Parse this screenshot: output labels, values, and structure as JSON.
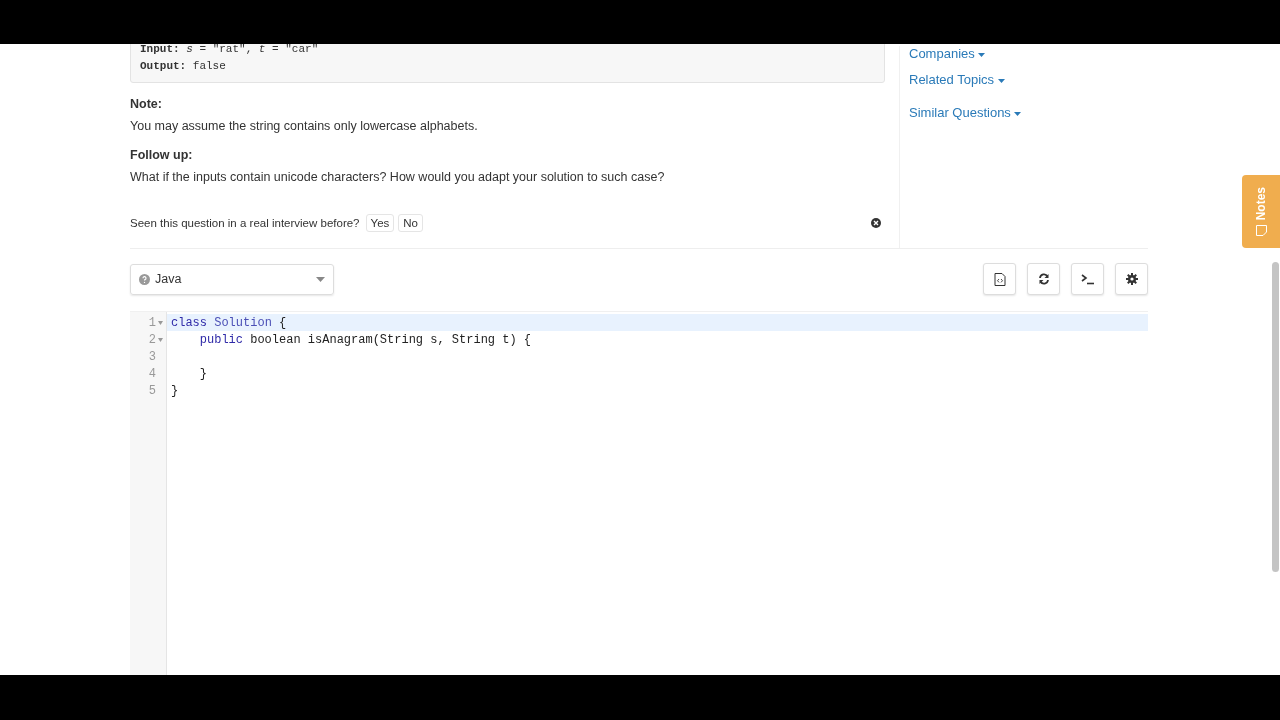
{
  "problem": {
    "example": [
      {
        "label": "Input:",
        "value": "*s* = \"rat\", *t* = \"car\""
      },
      {
        "label": "Output:",
        "value": "false"
      }
    ],
    "sections": [
      {
        "heading": "Note:",
        "text": "You may assume the string contains only lowercase alphabets."
      },
      {
        "heading": "Follow up:",
        "text": "What if the inputs contain unicode characters? How would you adapt your solution to such case?"
      }
    ],
    "feedback": {
      "question": "Seen this question in a real interview before?",
      "buttons": [
        "Yes",
        "No"
      ]
    }
  },
  "sidebar": {
    "links": [
      {
        "label": "Companies"
      },
      {
        "label": "Related Topics"
      },
      {
        "label": "Similar Questions"
      }
    ]
  },
  "editor": {
    "language": "Java",
    "lines": [
      {
        "number": "1",
        "foldable": true,
        "active": true,
        "tokens": [
          {
            "text": "class",
            "kind": "keyword"
          },
          {
            "text": " Solution",
            "kind": "def"
          },
          {
            "text": " {"
          }
        ]
      },
      {
        "number": "2",
        "foldable": true,
        "active": false,
        "tokens": [
          {
            "text": "    public",
            "kind": "keyword"
          },
          {
            "text": " boolean isAnagram(String s, String t) {"
          }
        ]
      },
      {
        "number": "3",
        "foldable": false,
        "active": false
      },
      {
        "number": "4",
        "foldable": false,
        "active": false,
        "tokens": [
          {
            "text": "    }"
          }
        ]
      },
      {
        "number": "5",
        "foldable": false,
        "active": false,
        "tokens": [
          {
            "text": "}"
          }
        ]
      }
    ]
  },
  "notes_tab": {
    "label": "Notes"
  }
}
